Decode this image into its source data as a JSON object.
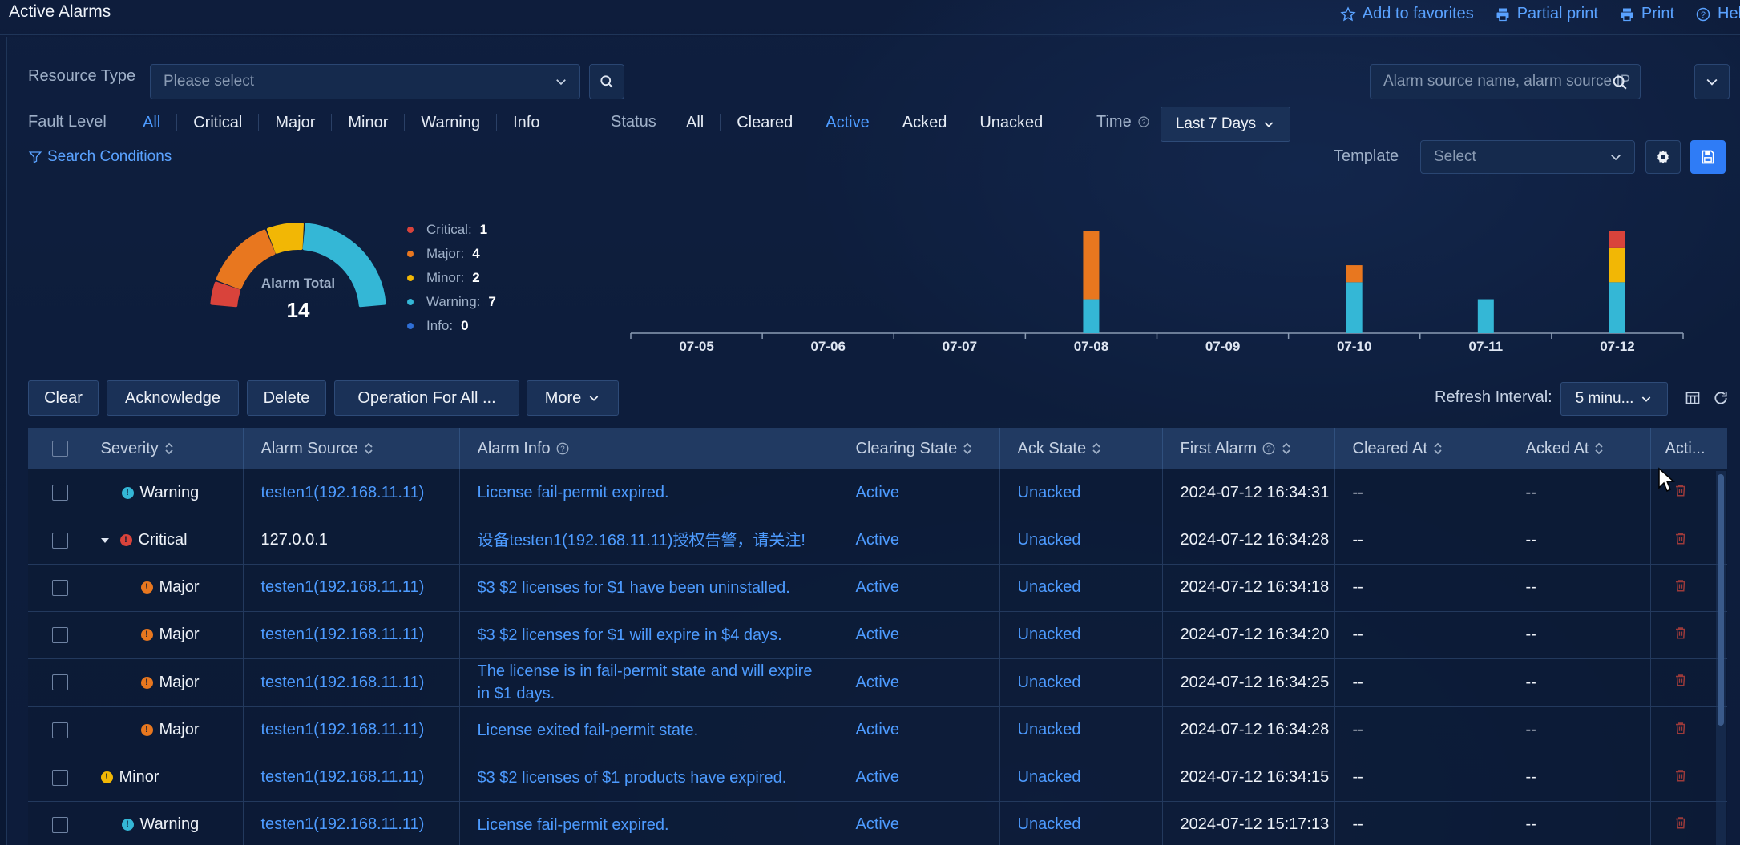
{
  "page": {
    "title": "Active Alarms"
  },
  "top_actions": [
    {
      "label": "Add to favorites",
      "icon": "star-icon"
    },
    {
      "label": "Partial print",
      "icon": "printer-icon"
    },
    {
      "label": "Print",
      "icon": "printer-icon"
    },
    {
      "label": "Help",
      "icon": "help-circle-icon"
    }
  ],
  "filters": {
    "resource_type_label": "Resource Type",
    "resource_type_placeholder": "Please select",
    "search_placeholder": "Alarm source name, alarm source IP",
    "fault_level_label": "Fault Level",
    "fault_levels": [
      "All",
      "Critical",
      "Major",
      "Minor",
      "Warning",
      "Info"
    ],
    "fault_level_selected": "All",
    "status_label": "Status",
    "statuses": [
      "All",
      "Cleared",
      "Active",
      "Acked",
      "Unacked"
    ],
    "status_selected": "Active",
    "time_label": "Time",
    "time_value": "Last 7 Days",
    "search_conditions": "Search Conditions",
    "template_label": "Template",
    "template_placeholder": "Select"
  },
  "summary": {
    "total_label": "Alarm Total",
    "total": 14,
    "legend": [
      {
        "label": "Critical:",
        "count": 1,
        "color": "#d9433b"
      },
      {
        "label": "Major:",
        "count": 4,
        "color": "#e8771f"
      },
      {
        "label": "Minor:",
        "count": 2,
        "color": "#f2b705"
      },
      {
        "label": "Warning:",
        "count": 7,
        "color": "#34b7d6"
      },
      {
        "label": "Info:",
        "count": 0,
        "color": "#2f6fd6"
      }
    ]
  },
  "chart_data": {
    "type": "bar",
    "stacked": true,
    "categories": [
      "07-05",
      "07-06",
      "07-07",
      "07-08",
      "07-09",
      "07-10",
      "07-11",
      "07-12"
    ],
    "series": [
      {
        "color": "#34b7d6",
        "values": [
          0,
          0,
          0,
          2,
          0,
          3,
          2,
          3
        ]
      },
      {
        "color": "#e8771f",
        "values": [
          0,
          0,
          0,
          4,
          0,
          1,
          0,
          0
        ]
      },
      {
        "color": "#f2b705",
        "values": [
          0,
          0,
          0,
          0,
          0,
          0,
          0,
          2
        ]
      },
      {
        "color": "#d9433b",
        "values": [
          0,
          0,
          0,
          0,
          0,
          0,
          0,
          1
        ]
      }
    ],
    "ylim": [
      0,
      6.5
    ],
    "grid": false
  },
  "toolbar": {
    "buttons": [
      "Clear",
      "Acknowledge",
      "Delete",
      "Operation For All ...",
      "More"
    ],
    "refresh_label": "Refresh Interval:",
    "refresh_value": "5 minu..."
  },
  "table": {
    "columns": [
      "",
      "Severity",
      "Alarm Source",
      "Alarm Info",
      "Clearing State",
      "Ack State",
      "First Alarm",
      "Cleared At",
      "Acked At",
      "Acti..."
    ],
    "rows": [
      {
        "severity": "Warning",
        "sev_color": "#34b7d6",
        "indent": 1,
        "expand": false,
        "source": "testen1(192.168.11.11)",
        "source_link": true,
        "info": "License fail-permit expired.",
        "clearing": "Active",
        "ack": "Unacked",
        "first": "2024-07-12 16:34:31",
        "cleared": "--",
        "acked": "--"
      },
      {
        "severity": "Critical",
        "sev_color": "#d9433b",
        "indent": 1,
        "expand": true,
        "source": "127.0.0.1",
        "source_link": false,
        "info": "设备testen1(192.168.11.11)授权告警，请关注!",
        "clearing": "Active",
        "ack": "Unacked",
        "first": "2024-07-12 16:34:28",
        "cleared": "--",
        "acked": "--"
      },
      {
        "severity": "Major",
        "sev_color": "#e8771f",
        "indent": 2,
        "expand": false,
        "source": "testen1(192.168.11.11)",
        "source_link": true,
        "info": "$3 $2 licenses for $1 have been uninstalled.",
        "clearing": "Active",
        "ack": "Unacked",
        "first": "2024-07-12 16:34:18",
        "cleared": "--",
        "acked": "--"
      },
      {
        "severity": "Major",
        "sev_color": "#e8771f",
        "indent": 2,
        "expand": false,
        "source": "testen1(192.168.11.11)",
        "source_link": true,
        "info": "$3 $2 licenses for $1 will expire in $4 days.",
        "clearing": "Active",
        "ack": "Unacked",
        "first": "2024-07-12 16:34:20",
        "cleared": "--",
        "acked": "--"
      },
      {
        "severity": "Major",
        "sev_color": "#e8771f",
        "indent": 2,
        "expand": false,
        "source": "testen1(192.168.11.11)",
        "source_link": true,
        "info": "The license is in fail-permit state and will expire in $1 days.",
        "clearing": "Active",
        "ack": "Unacked",
        "first": "2024-07-12 16:34:25",
        "cleared": "--",
        "acked": "--"
      },
      {
        "severity": "Major",
        "sev_color": "#e8771f",
        "indent": 2,
        "expand": false,
        "source": "testen1(192.168.11.11)",
        "source_link": true,
        "info": "License exited fail-permit state.",
        "clearing": "Active",
        "ack": "Unacked",
        "first": "2024-07-12 16:34:28",
        "cleared": "--",
        "acked": "--"
      },
      {
        "severity": "Minor",
        "sev_color": "#f2b705",
        "indent": 0,
        "expand": false,
        "source": "testen1(192.168.11.11)",
        "source_link": true,
        "info": "$3 $2 licenses of $1 products have expired.",
        "clearing": "Active",
        "ack": "Unacked",
        "first": "2024-07-12 16:34:15",
        "cleared": "--",
        "acked": "--"
      },
      {
        "severity": "Warning",
        "sev_color": "#34b7d6",
        "indent": 1,
        "expand": false,
        "source": "testen1(192.168.11.11)",
        "source_link": true,
        "info": "License fail-permit expired.",
        "clearing": "Active",
        "ack": "Unacked",
        "first": "2024-07-12 15:17:13",
        "cleared": "--",
        "acked": "--"
      }
    ]
  }
}
